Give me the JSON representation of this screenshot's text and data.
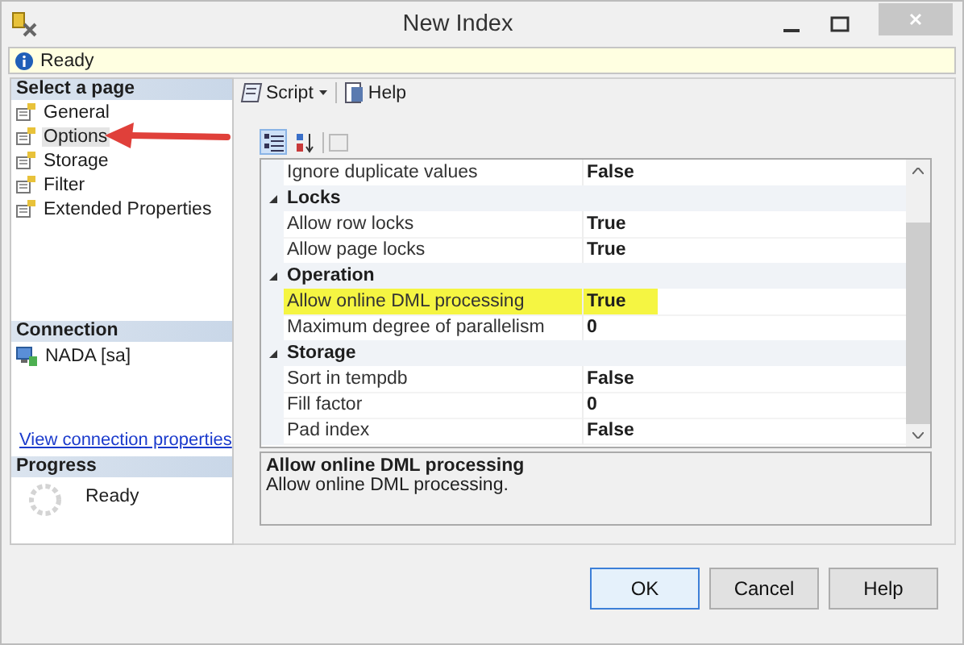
{
  "window": {
    "title": "New Index"
  },
  "status": {
    "text": "Ready"
  },
  "pages": {
    "header": "Select a page",
    "items": [
      {
        "label": "General",
        "selected": false
      },
      {
        "label": "Options",
        "selected": true
      },
      {
        "label": "Storage",
        "selected": false
      },
      {
        "label": "Filter",
        "selected": false
      },
      {
        "label": "Extended Properties",
        "selected": false
      }
    ]
  },
  "connection": {
    "header": "Connection",
    "server": "NADA [sa]",
    "link": "View connection properties"
  },
  "progress": {
    "header": "Progress",
    "status": "Ready"
  },
  "toolbar": {
    "script": "Script",
    "help": "Help"
  },
  "grid": {
    "categorized": true,
    "rows": [
      {
        "kind": "property",
        "name": "Ignore duplicate values",
        "value": "False",
        "highlighted": false
      },
      {
        "kind": "category",
        "name": "Locks",
        "expanded": true,
        "children": [
          {
            "name": "Allow row locks",
            "value": "True",
            "highlighted": false
          },
          {
            "name": "Allow page locks",
            "value": "True",
            "highlighted": false
          }
        ]
      },
      {
        "kind": "category",
        "name": "Operation",
        "expanded": true,
        "children": [
          {
            "name": "Allow online DML processing",
            "value": "True",
            "highlighted": true
          },
          {
            "name": "Maximum degree of parallelism",
            "value": "0",
            "highlighted": false
          }
        ]
      },
      {
        "kind": "category",
        "name": "Storage",
        "expanded": true,
        "children": [
          {
            "name": "Sort in tempdb",
            "value": "False",
            "highlighted": false
          },
          {
            "name": "Fill factor",
            "value": "0",
            "highlighted": false
          },
          {
            "name": "Pad index",
            "value": "False",
            "highlighted": false
          }
        ]
      }
    ]
  },
  "description": {
    "title": "Allow online DML processing",
    "text": "Allow online DML processing."
  },
  "buttons": [
    {
      "label": "OK",
      "default": true
    },
    {
      "label": "Cancel",
      "default": false
    },
    {
      "label": "Help",
      "default": false
    }
  ]
}
